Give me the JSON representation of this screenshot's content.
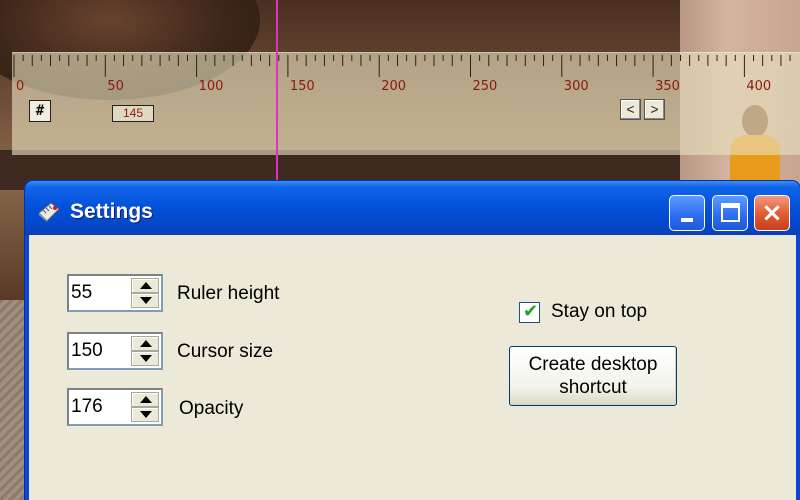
{
  "window": {
    "title": "Settings",
    "icon": "ruler-app-icon",
    "caption_buttons": {
      "minimize": "minimize-icon",
      "maximize": "maximize-icon",
      "close": "×"
    }
  },
  "ruler": {
    "tick_labels": [
      "0",
      "50",
      "100",
      "150",
      "200",
      "250",
      "300",
      "350",
      "400"
    ],
    "hash_button": "#",
    "position_readout": "145",
    "nav_prev": "<",
    "nav_next": ">",
    "cursor_color": "#e030c8"
  },
  "settings": {
    "ruler_height": {
      "value": "55",
      "label": "Ruler height"
    },
    "cursor_size": {
      "value": "150",
      "label": "Cursor size"
    },
    "opacity": {
      "value": "176",
      "label": "Opacity"
    },
    "stay_on_top": {
      "label": "Stay on top",
      "checked": true
    },
    "shortcut_button": {
      "line1": "Create desktop",
      "line2": "shortcut"
    }
  },
  "colors": {
    "titlebar": "#0552da",
    "client_bg": "#ece9d8",
    "tick_label": "#8a1a10"
  }
}
